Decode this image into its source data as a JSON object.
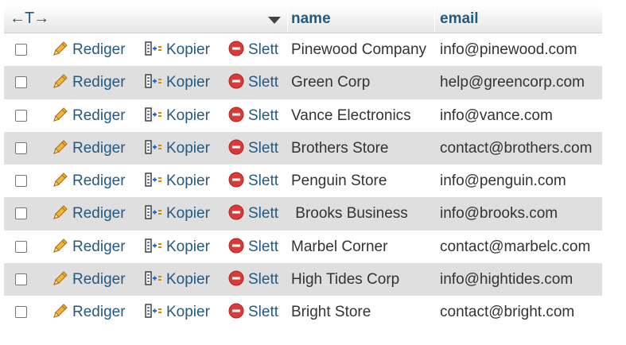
{
  "header": {
    "sort_arrows": "←T→",
    "col_name": "name",
    "col_email": "email"
  },
  "actions": {
    "edit": "Rediger",
    "copy": "Kopier",
    "delete": "Slett"
  },
  "icons": {
    "edit": "pencil-icon",
    "copy": "copy-icon",
    "delete": "delete-icon"
  },
  "colors": {
    "link": "#235a81",
    "alt_row": "#dfdfdf",
    "delete_red": "#d93b3b"
  },
  "rows": [
    {
      "name": "Pinewood Company",
      "email": "info@pinewood.com"
    },
    {
      "name": "Green Corp",
      "email": "help@greencorp.com"
    },
    {
      "name": "Vance Electronics",
      "email": "info@vance.com"
    },
    {
      "name": "Brothers Store",
      "email": "contact@brothers.com"
    },
    {
      "name": "Penguin Store",
      "email": "info@penguin.com"
    },
    {
      "name": " Brooks Business",
      "email": "info@brooks.com"
    },
    {
      "name": "Marbel Corner",
      "email": "contact@marbelc.com"
    },
    {
      "name": "High Tides Corp",
      "email": "info@hightides.com"
    },
    {
      "name": "Bright Store",
      "email": "contact@bright.com"
    }
  ]
}
